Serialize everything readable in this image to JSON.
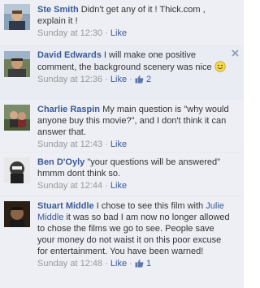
{
  "comments": [
    {
      "author": "Ste Smith",
      "text": "Didn't get any of it ! Thick.com , explain it !",
      "timestamp": "Sunday at 12:30",
      "like_label": "Like",
      "separator": "·"
    },
    {
      "author": "David Edwards",
      "text": "I will make one positive comment, the background scenery was nice",
      "timestamp": "Sunday at 12:36",
      "like_label": "Like",
      "like_count": "2",
      "separator": "·",
      "emoticon": "smiley-emoticon",
      "close_icon": "close-icon"
    },
    {
      "author": "Charlie Raspin",
      "text": "My main question is \"why would anyone buy this movie?\", and I don't think it can answer that.",
      "timestamp": "Sunday at 12:43",
      "like_label": "Like",
      "separator": "·"
    },
    {
      "author": "Ben D'Oyly",
      "text": "\"your questions will be answered\" hmmm dont think so.",
      "timestamp": "Sunday at 12:44",
      "like_label": "Like",
      "separator": "·"
    },
    {
      "author": "Stuart Middle",
      "text_before": "I chose to see this film with",
      "mention": "Julie Middle",
      "text_after": "it was so bad I am now no longer allowed to chose the films we go to see. People save your money do not waist it on this poor excuse for entertainment. You have been warned!",
      "timestamp": "Sunday at 12:48",
      "like_label": "Like",
      "like_count": "1",
      "separator": "·"
    }
  ],
  "colors": {
    "background": "#edeff4",
    "link": "#3b5998",
    "meta": "#999999",
    "text": "#333333"
  }
}
